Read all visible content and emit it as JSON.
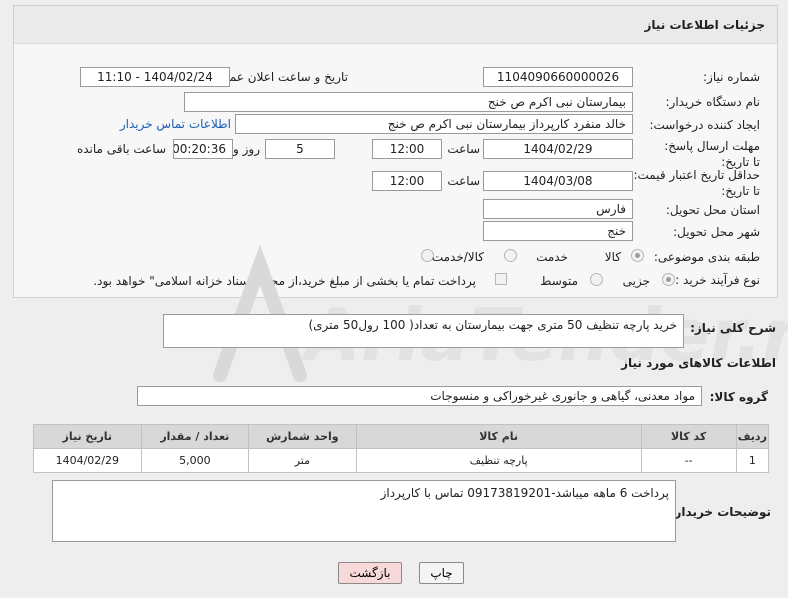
{
  "header": {
    "title": "جزئیات اطلاعات نیاز"
  },
  "fields": {
    "need_number_label": "شماره نیاز:",
    "need_number": "1104090660000026",
    "announce_label": "تاریخ و ساعت اعلان عمومی:",
    "announce_value": "1404/02/24 - 11:10",
    "buyer_org_label": "نام دستگاه خریدار:",
    "buyer_org": "بیمارستان نبی اکرم  ص  خنج",
    "creator_label": "ایجاد کننده درخواست:",
    "creator": "خالد منفرد کارپرداز بیمارستان نبی اکرم  ص  خنج",
    "contact_link": "اطلاعات تماس خریدار",
    "deadline_label": "مهلت ارسال پاسخ: تا تاریخ:",
    "deadline_date": "1404/02/29",
    "hour_label": "ساعت",
    "deadline_time": "12:00",
    "days_value": "5",
    "days_label": "روز و",
    "remaining_value": "00:20:36",
    "remaining_label": "ساعت باقی مانده",
    "price_valid_label": "حداقل تاریخ اعتبار قیمت: تا تاریخ:",
    "price_valid_date": "1404/03/08",
    "price_hour_label": "ساعت",
    "price_valid_time": "12:00",
    "province_label": "استان محل تحویل:",
    "province": "فارس",
    "city_label": "شهر محل تحویل:",
    "city": "خنج",
    "category_label": "طبقه بندی موضوعی:",
    "category_options": [
      "کالا",
      "خدمت",
      "کالا/خدمت"
    ],
    "process_label": "نوع فرآیند خرید :",
    "process_options": [
      "جزیی",
      "متوسط"
    ],
    "payment_note": "پرداخت تمام یا بخشی از مبلغ خرید،از محل \"اسناد خزانه اسلامی\" خواهد بود."
  },
  "description": {
    "label": "شرح کلی نیاز:",
    "text": "خرید پارچه تنظیف 50 متری جهت بیمارستان به تعداد( 100 رول50 متری)"
  },
  "goods_section": {
    "title": "اطلاعات کالاهای مورد نیاز",
    "group_label": "گروه کالا:",
    "group_value": "مواد معدنی، گیاهی و جانوری غیرخوراکی و منسوجات"
  },
  "table": {
    "headers": [
      "ردیف",
      "کد کالا",
      "نام کالا",
      "واحد شمارش",
      "تعداد / مقدار",
      "تاریخ نیاز"
    ],
    "rows": [
      [
        "1",
        "--",
        "پارچه تنظیف",
        "متر",
        "5,000",
        "1404/02/29"
      ]
    ]
  },
  "buyer_notes": {
    "label": "توضیحات خریدار:",
    "text": "پرداخت 6 ماهه میباشد-09173819201 تماس با کارپرداز"
  },
  "buttons": {
    "print": "چاپ",
    "back": "بازگشت"
  },
  "watermark": {
    "text": "AriaTender.net"
  },
  "colors": {
    "link": "#1a5fb4",
    "back_button": "#f7d9d9",
    "header_bg": "#eaeaea"
  }
}
